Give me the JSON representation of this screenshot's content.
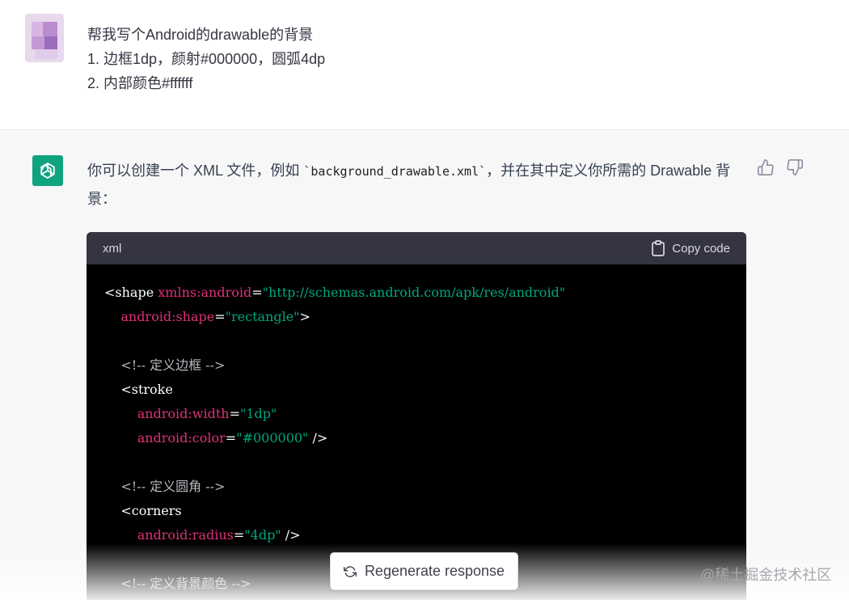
{
  "user_message": {
    "lines": [
      "帮我写个Android的drawable的背景",
      "1. 边框1dp，颜射#000000，圆弧4dp",
      "2. 内部颜色#ffffff"
    ]
  },
  "assistant_message": {
    "intro_prefix": "你可以创建一个 XML 文件，例如 ",
    "intro_filename": "`background_drawable.xml`",
    "intro_suffix": "，并在其中定义你所需的 Drawable 背景：",
    "code_block": {
      "language": "xml",
      "copy_label": "Copy code",
      "lines": [
        [
          {
            "t": "tag",
            "v": "<shape "
          },
          {
            "t": "attr",
            "v": "xmlns:android"
          },
          {
            "t": "tag",
            "v": "="
          },
          {
            "t": "str",
            "v": "\"http://schemas.android.com/apk/res/android\""
          }
        ],
        [
          {
            "t": "tag",
            "v": "    "
          },
          {
            "t": "attr",
            "v": "android:shape"
          },
          {
            "t": "tag",
            "v": "="
          },
          {
            "t": "str",
            "v": "\"rectangle\""
          },
          {
            "t": "tag",
            "v": ">"
          }
        ],
        [
          {
            "t": "tag",
            "v": ""
          }
        ],
        [
          {
            "t": "cmt",
            "v": "    <!-- 定义边框 -->"
          }
        ],
        [
          {
            "t": "tag",
            "v": "    <stroke"
          }
        ],
        [
          {
            "t": "tag",
            "v": "        "
          },
          {
            "t": "attr",
            "v": "android:width"
          },
          {
            "t": "tag",
            "v": "="
          },
          {
            "t": "str",
            "v": "\"1dp\""
          }
        ],
        [
          {
            "t": "tag",
            "v": "        "
          },
          {
            "t": "attr",
            "v": "android:color"
          },
          {
            "t": "tag",
            "v": "="
          },
          {
            "t": "str",
            "v": "\"#000000\""
          },
          {
            "t": "tag",
            "v": " />"
          }
        ],
        [
          {
            "t": "tag",
            "v": ""
          }
        ],
        [
          {
            "t": "cmt",
            "v": "    <!-- 定义圆角 -->"
          }
        ],
        [
          {
            "t": "tag",
            "v": "    <corners"
          }
        ],
        [
          {
            "t": "tag",
            "v": "        "
          },
          {
            "t": "attr",
            "v": "android:radius"
          },
          {
            "t": "tag",
            "v": "="
          },
          {
            "t": "str",
            "v": "\"4dp\""
          },
          {
            "t": "tag",
            "v": " />"
          }
        ],
        [
          {
            "t": "tag",
            "v": ""
          }
        ],
        [
          {
            "t": "cmt",
            "v": "    <!-- 定义背景颜色 -->"
          }
        ]
      ]
    }
  },
  "regenerate_label": "Regenerate response",
  "watermark": "@稀土掘金技术社区",
  "colors": {
    "brand_green": "#10a37f",
    "code_bg": "#000000",
    "code_header_bg": "#343541",
    "attr": "#df3079",
    "string": "#00a67d"
  },
  "icons": [
    "openai-logo-icon",
    "thumbs-up-icon",
    "thumbs-down-icon",
    "clipboard-icon",
    "refresh-icon"
  ]
}
